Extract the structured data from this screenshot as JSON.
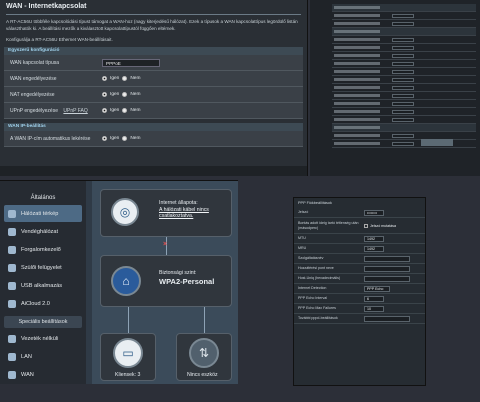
{
  "wan": {
    "title": "WAN - Internetkapcsolat",
    "description": "A RT-AC56U többféle kapcsolódási típust támogat a WAN-hoz (nagy kiterjedésű hálózat). Ezek a típusok a WAN kapcsolattípus legördülő listán választhatók ki. A beállítási mezők a kiválasztott kapcsolattípustól függően eltérnek.",
    "note": "Konfigurálja a RT-AC56U Ethernet WAN-beállításait.",
    "section_basic": "Egyszerű konfiguráció",
    "section_ip": "WAN IP-beállítás",
    "rows": [
      {
        "label": "WAN kapcsolat típusa",
        "type": "select",
        "value": "PPPoE"
      },
      {
        "label": "WAN engedélyezése",
        "type": "radio",
        "yes": "Igen",
        "no": "Nem",
        "selected": "yes"
      },
      {
        "label": "NAT engedélyezése",
        "type": "radio",
        "yes": "Igen",
        "no": "Nem",
        "selected": "yes"
      },
      {
        "label": "UPnP engedélyezése",
        "link": "UPnP FAQ",
        "type": "radio",
        "yes": "Igen",
        "no": "Nem",
        "selected": "yes"
      }
    ],
    "ip_row": {
      "label": "A WAN IP-cím automatikus lekérése",
      "yes": "Igen",
      "no": "Nem",
      "selected": "yes"
    }
  },
  "network_map": {
    "sidebar_title": "Általános",
    "items": [
      {
        "label": "Hálózati térkép",
        "active": true
      },
      {
        "label": "Vendéghálózat",
        "active": false
      },
      {
        "label": "Forgalomkezelő",
        "active": false
      },
      {
        "label": "Szülői felügyelet",
        "active": false
      },
      {
        "label": "USB alkalmazás",
        "active": false
      },
      {
        "label": "AiCloud 2.0",
        "active": false
      }
    ],
    "advanced_title": "Speciális beállítások",
    "advanced_items": [
      {
        "label": "Vezeték nélküli"
      },
      {
        "label": "LAN"
      },
      {
        "label": "WAN"
      }
    ],
    "internet_status_label": "Internet állapota:",
    "internet_status_value": "A hálózati kábel nincs csatlakoztatva.",
    "security_label": "Biztonsági szint:",
    "security_value": "WPA2-Personal",
    "clients_label": "Kliensek:",
    "clients_count": "3",
    "usb_label": "Nincs eszköz"
  },
  "ppp": {
    "title": "PPP Fiókbeállítások",
    "rows": [
      {
        "label": "Jelszó",
        "value": "••••••••"
      },
      {
        "label": "Bontás adott ideig tartó tétlenség után (másodperc)",
        "value": "Jelszó mutatása"
      },
      {
        "label": "MTU",
        "value": "1492"
      },
      {
        "label": "MRU",
        "value": "1492"
      },
      {
        "label": "Szolgáltatásnév",
        "value": ""
      },
      {
        "label": "Hozzáférési pont neve",
        "value": ""
      },
      {
        "label": "Host-Uniq (hexadecimális)",
        "value": ""
      },
      {
        "label": "Internet Detection",
        "value": "PPP Echo"
      },
      {
        "label": "PPP Echo Interval",
        "value": "6"
      },
      {
        "label": "PPP Echo Max Failures",
        "value": "10"
      },
      {
        "label": "További pppd-beállítások",
        "value": ""
      }
    ]
  }
}
